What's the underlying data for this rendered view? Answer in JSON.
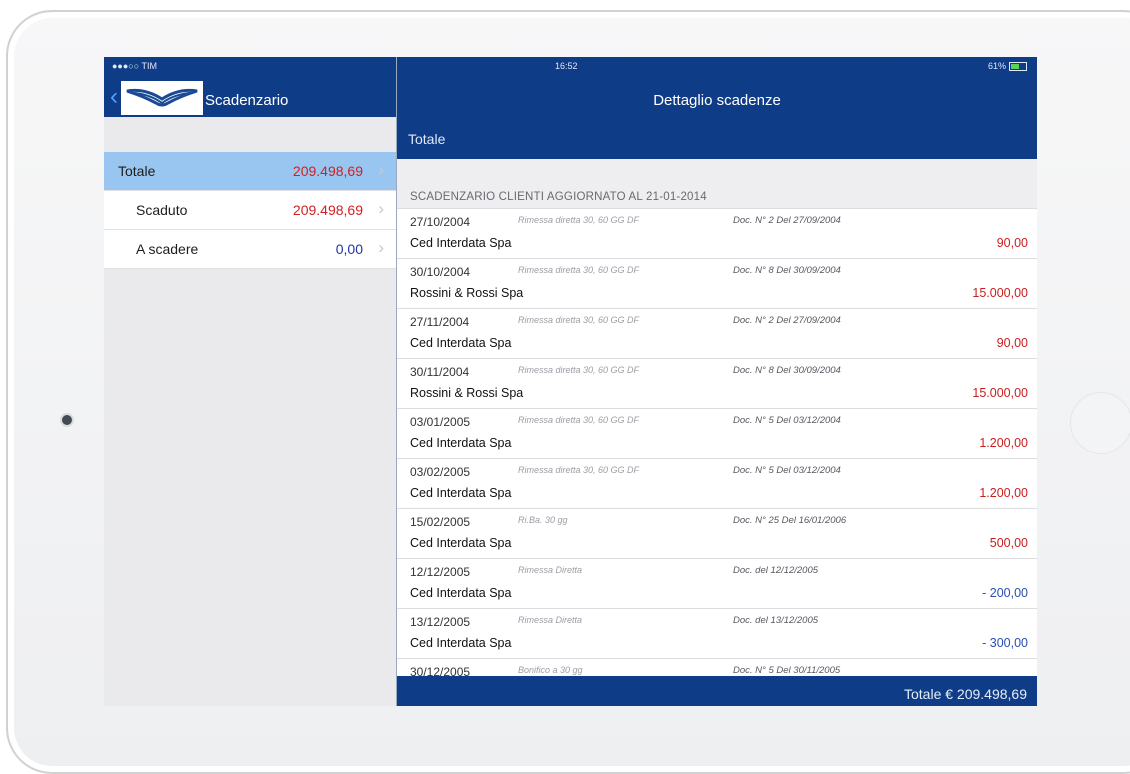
{
  "status_bar": {
    "carrier": "●●●○○ TIM",
    "time": "16:52",
    "battery": "61%"
  },
  "left_nav": {
    "title": "Scadenzario"
  },
  "left_list": [
    {
      "label": "Totale",
      "value": "209.498,69",
      "selected": true
    },
    {
      "label": "Scaduto",
      "value": "209.498,69",
      "selected": false
    },
    {
      "label": "A scadere",
      "value": "0,00",
      "selected": false
    }
  ],
  "right_nav": {
    "title": "Dettaglio scadenze"
  },
  "sub_header": "Totale",
  "section_header": "SCADENZARIO CLIENTI  AGGIORNATO AL 21-01-2014",
  "entries": [
    {
      "date": "27/10/2004",
      "mode": "Rimessa diretta 30, 60 GG DF",
      "doc": "Doc. N° 2 Del 27/09/2004",
      "customer": "Ced Interdata Spa",
      "amount": "90,00",
      "negative": false
    },
    {
      "date": "30/10/2004",
      "mode": "Rimessa diretta 30, 60 GG DF",
      "doc": "Doc. N° 8 Del 30/09/2004",
      "customer": "Rossini & Rossi Spa",
      "amount": "15.000,00",
      "negative": false
    },
    {
      "date": "27/11/2004",
      "mode": "Rimessa diretta 30, 60 GG DF",
      "doc": "Doc. N° 2 Del 27/09/2004",
      "customer": "Ced Interdata Spa",
      "amount": "90,00",
      "negative": false
    },
    {
      "date": "30/11/2004",
      "mode": "Rimessa diretta 30, 60 GG DF",
      "doc": "Doc. N° 8 Del 30/09/2004",
      "customer": "Rossini & Rossi Spa",
      "amount": "15.000,00",
      "negative": false
    },
    {
      "date": "03/01/2005",
      "mode": "Rimessa diretta 30, 60 GG DF",
      "doc": "Doc. N° 5 Del 03/12/2004",
      "customer": "Ced Interdata Spa",
      "amount": "1.200,00",
      "negative": false
    },
    {
      "date": "03/02/2005",
      "mode": "Rimessa diretta 30, 60 GG DF",
      "doc": "Doc. N° 5 Del 03/12/2004",
      "customer": "Ced Interdata Spa",
      "amount": "1.200,00",
      "negative": false
    },
    {
      "date": "15/02/2005",
      "mode": "Ri.Ba. 30 gg",
      "doc": "Doc. N° 25 Del 16/01/2006",
      "customer": "Ced Interdata Spa",
      "amount": "500,00",
      "negative": false
    },
    {
      "date": "12/12/2005",
      "mode": "Rimessa Diretta",
      "doc": "Doc. del 12/12/2005",
      "customer": "Ced Interdata Spa",
      "amount": "- 200,00",
      "negative": true
    },
    {
      "date": "13/12/2005",
      "mode": "Rimessa Diretta",
      "doc": "Doc. del 13/12/2005",
      "customer": "Ced Interdata Spa",
      "amount": "- 300,00",
      "negative": true
    },
    {
      "date": "30/12/2005",
      "mode": "Bonifico a 30 gg",
      "doc": "Doc. N° 5 Del 30/11/2005",
      "customer": "",
      "amount": "",
      "negative": false
    }
  ],
  "footer_total": "Totale € 209.498,69",
  "colors": {
    "nav_blue": "#0f3c86",
    "selected_row": "#99c6f0",
    "positive_amount": "#c81e1e",
    "negative_amount": "#2a4db0"
  }
}
